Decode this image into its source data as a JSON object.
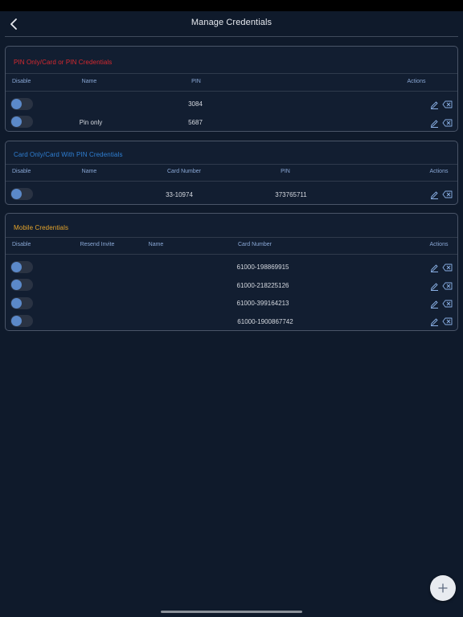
{
  "header": {
    "title": "Manage Credentials"
  },
  "colors": {
    "pin_title": "#d9292f",
    "card_title": "#2f7fd3",
    "mobile_title": "#e6a52b",
    "toggle_knob": "#5b89c9"
  },
  "icons": {
    "back": "chevron-left-icon",
    "edit": "pencil-icon",
    "delete": "backspace-x-icon",
    "add": "plus-icon"
  },
  "pin_section": {
    "title": "PIN Only/Card or PIN Credentials",
    "columns": {
      "disable": "Disable",
      "name": "Name",
      "pin": "PIN",
      "actions": "Actions"
    },
    "rows": [
      {
        "name": "",
        "pin": "3084"
      },
      {
        "name": "Pin only",
        "pin": "5687"
      }
    ]
  },
  "card_section": {
    "title": "Card Only/Card With PIN Credentials",
    "columns": {
      "disable": "Disable",
      "name": "Name",
      "card_number": "Card Number",
      "pin": "PIN",
      "actions": "Actions"
    },
    "rows": [
      {
        "name": "",
        "card_number": "33-10974",
        "pin": "373765711"
      }
    ]
  },
  "mobile_section": {
    "title": "Mobile Credentials",
    "columns": {
      "disable": "Disable",
      "resend_invite": "Resend Invite",
      "name": "Name",
      "card_number": "Card Number",
      "actions": "Actions"
    },
    "rows": [
      {
        "card_number": "61000-198869915"
      },
      {
        "card_number": "61000-218225126"
      },
      {
        "card_number": "61000-399164213"
      },
      {
        "card_number": "61000-1900867742"
      }
    ]
  }
}
